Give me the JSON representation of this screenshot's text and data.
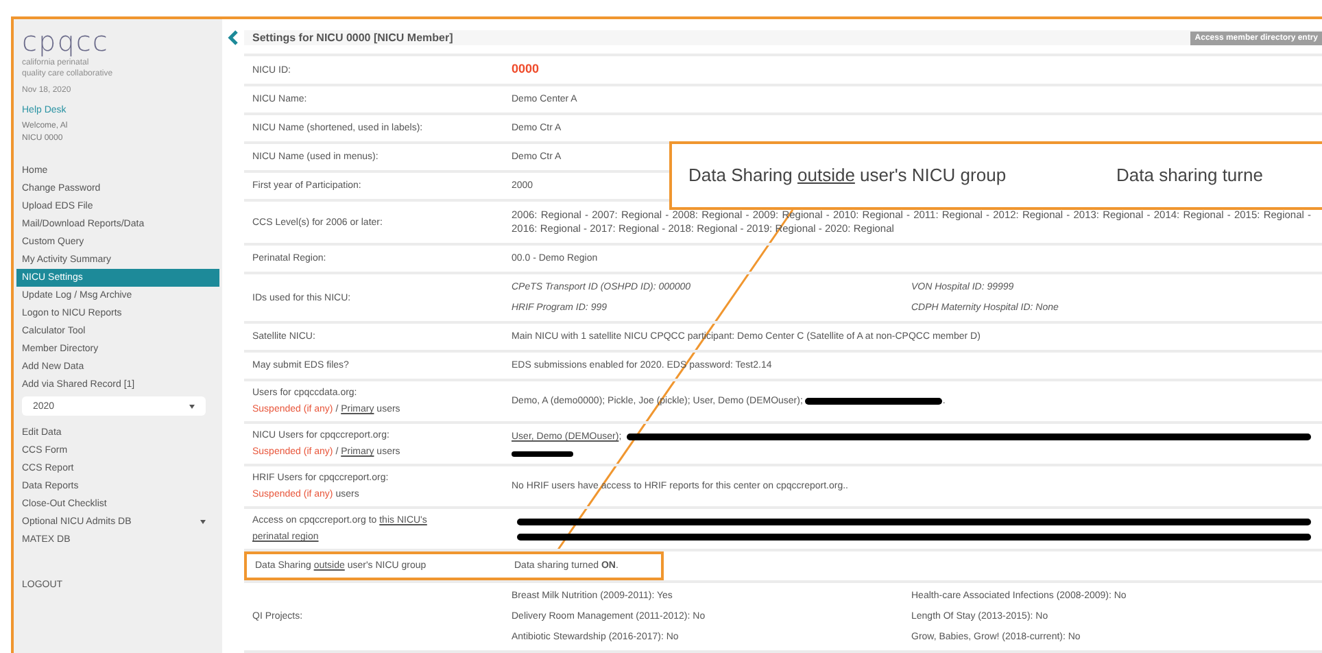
{
  "sidebar": {
    "logo": "cpqcc",
    "tagline": [
      "california perinatal",
      "quality care collaborative"
    ],
    "date": "Nov 18, 2020",
    "help": "Help Desk",
    "welcome": [
      "Welcome, Al",
      "NICU 0000"
    ],
    "groups": [
      [
        {
          "kind": "link",
          "label": "Home",
          "selected": false
        },
        {
          "kind": "link",
          "label": "Change Password",
          "selected": false
        },
        {
          "kind": "link",
          "label": "Upload EDS File",
          "selected": false
        },
        {
          "kind": "link",
          "label": "Mail/Download Reports/Data",
          "selected": false
        },
        {
          "kind": "link",
          "label": "Custom Query",
          "selected": false
        },
        {
          "kind": "link",
          "label": "My Activity Summary",
          "selected": false
        },
        {
          "kind": "link",
          "label": "NICU Settings",
          "selected": true
        },
        {
          "kind": "link",
          "label": "Update Log / Msg Archive",
          "selected": false
        },
        {
          "kind": "link",
          "label": "Logon to NICU Reports",
          "selected": false
        },
        {
          "kind": "link",
          "label": "Calculator Tool",
          "selected": false
        },
        {
          "kind": "link",
          "label": "Member Directory",
          "selected": false
        },
        {
          "kind": "link",
          "label": "Add New Data",
          "selected": false
        },
        {
          "kind": "link",
          "label": "Add via Shared Record [1]",
          "selected": false
        },
        {
          "kind": "select",
          "label": "2020",
          "selected": false
        }
      ],
      [
        {
          "kind": "link",
          "label": "Edit Data",
          "selected": false
        },
        {
          "kind": "link",
          "label": "CCS Form",
          "selected": false
        },
        {
          "kind": "link",
          "label": "CCS Report",
          "selected": false
        },
        {
          "kind": "link",
          "label": "Data Reports",
          "selected": false
        },
        {
          "kind": "link",
          "label": "Close-Out Checklist",
          "selected": false
        },
        {
          "kind": "submenu",
          "label": "Optional NICU Admits DB",
          "selected": false
        },
        {
          "kind": "link",
          "label": "MATEX DB",
          "selected": false
        }
      ],
      [
        {
          "kind": "link",
          "label": "LOGOUT",
          "selected": false
        }
      ]
    ]
  },
  "header": {
    "title": "Settings for NICU 0000 [NICU Member]",
    "button": "Access member directory entry"
  },
  "rows": [
    {
      "label": [
        "NICU ID:"
      ],
      "columns": [
        [
          [
            {
              "kind": "accent",
              "text": "0000"
            }
          ]
        ]
      ]
    },
    {
      "label": [
        "NICU Name:"
      ],
      "columns": [
        [
          "Demo Center A"
        ]
      ]
    },
    {
      "label": [
        "NICU Name (shortened, used in labels):"
      ],
      "columns": [
        [
          "Demo Ctr A"
        ]
      ]
    },
    {
      "label": [
        "NICU Name (used in menus):"
      ],
      "columns": [
        [
          "Demo Ctr A"
        ]
      ]
    },
    {
      "label": [
        "First year of Participation:"
      ],
      "columns": [
        [
          "2000"
        ]
      ]
    },
    {
      "label": [
        "CCS Level(s) for 2006 or later:"
      ],
      "columns": [
        [
          "2006: Regional  -  2007: Regional  -  2008: Regional  -  2009: Regional  -  2010: Regional  -  2011: Regional  -  2012: Regional  -  2013: Regional  -  2014: Regional  -  2015: Regional  -  2016: Regional  -  2017: Regional  -  2018: Regional  -  2019: Regional  -  2020: Regional"
        ]
      ]
    },
    {
      "label": [
        "Perinatal Region:"
      ],
      "columns": [
        [
          "00.0 - Demo Region"
        ]
      ]
    },
    {
      "label": [
        "IDs used for this NICU:"
      ],
      "columns": [
        [
          [
            {
              "kind": "italic",
              "text": "CPeTS Transport ID (OSHPD ID): 000000"
            }
          ],
          [
            {
              "kind": "italic",
              "text": "HRIF Program ID: 999"
            }
          ]
        ],
        [
          [
            {
              "kind": "italic",
              "text": "VON Hospital ID: 99999"
            }
          ],
          [
            {
              "kind": "italic",
              "text": "CDPH Maternity Hospital ID: None"
            }
          ]
        ]
      ]
    },
    {
      "label": [
        "Satellite NICU:"
      ],
      "columns": [
        [
          "Main NICU with 1 satellite NICU CPQCC participant: Demo Center C (Satellite of A at non-CPQCC member D)"
        ]
      ]
    },
    {
      "label": [
        "May submit EDS files?"
      ],
      "columns": [
        [
          "EDS submissions enabled for 2020. EDS password: Test2.14"
        ]
      ]
    },
    {
      "label": [
        "Users for cpqccdata.org:",
        [
          {
            "kind": "red",
            "text": "Suspended (if any)"
          },
          {
            "kind": "text",
            "text": " / "
          },
          {
            "kind": "link",
            "text": "Primary"
          },
          {
            "kind": "text",
            "text": " users"
          }
        ]
      ],
      "columns": [
        [
          [
            {
              "kind": "text",
              "text": "Demo, A (demo0000); Pickle, Joe (pickle); User, Demo (DEMOuser); "
            },
            {
              "kind": "blot"
            },
            {
              "kind": "text",
              "text": "."
            }
          ]
        ]
      ]
    },
    {
      "label": [
        "NICU Users for cpqccreport.org:",
        [
          {
            "kind": "red",
            "text": "Suspended (if any)"
          },
          {
            "kind": "text",
            "text": " / "
          },
          {
            "kind": "link",
            "text": "Primary"
          },
          {
            "kind": "text",
            "text": " users"
          }
        ]
      ],
      "columns": [
        [
          [
            {
              "kind": "link",
              "text": "User, Demo (DEMOuser)"
            },
            {
              "kind": "text",
              "text": ";"
            },
            {
              "kind": "redaction"
            }
          ],
          [
            {
              "kind": "stub"
            }
          ]
        ]
      ]
    },
    {
      "label": [
        "HRIF Users for cpqccreport.org:",
        [
          {
            "kind": "red",
            "text": "Suspended (if any)"
          },
          {
            "kind": "text",
            "text": " users"
          }
        ]
      ],
      "columns": [
        [
          "No HRIF users have access to HRIF reports for this center on cpqccreport.org.."
        ]
      ]
    },
    {
      "label": [
        [
          {
            "kind": "text",
            "text": "Access on cpqccreport.org to "
          },
          {
            "kind": "link",
            "text": "this NICU's"
          }
        ],
        [
          {
            "kind": "link",
            "text": "perinatal region"
          }
        ]
      ],
      "columns": [
        [
          [
            {
              "kind": "redaction"
            }
          ],
          [
            {
              "kind": "redaction"
            }
          ]
        ]
      ]
    },
    {
      "label": [
        [
          {
            "kind": "text",
            "text": "Data Sharing "
          },
          {
            "kind": "link",
            "text": "outside"
          },
          {
            "kind": "text",
            "text": " user's NICU group"
          }
        ]
      ],
      "highlighted": true,
      "columns": [
        [
          [
            {
              "kind": "rich",
              "text": "Data sharing turned **ON**."
            }
          ]
        ]
      ]
    },
    {
      "label": [
        "QI Projects:"
      ],
      "columns": [
        [
          "Breast Milk Nutrition (2009-2011): Yes",
          "Delivery Room Management (2011-2012): No",
          "Antibiotic Stewardship (2016-2017): No"
        ],
        [
          "Health-care Associated Infections (2008-2009): No",
          "Length Of Stay (2013-2015): No",
          "Grow, Babies, Grow! (2018-current): No"
        ]
      ]
    }
  ],
  "callout": {
    "label": [
      {
        "kind": "text",
        "text": "Data Sharing "
      },
      {
        "kind": "link",
        "text": "outside"
      },
      {
        "kind": "text",
        "text": " user's NICU group"
      }
    ],
    "value": "Data sharing turne"
  }
}
